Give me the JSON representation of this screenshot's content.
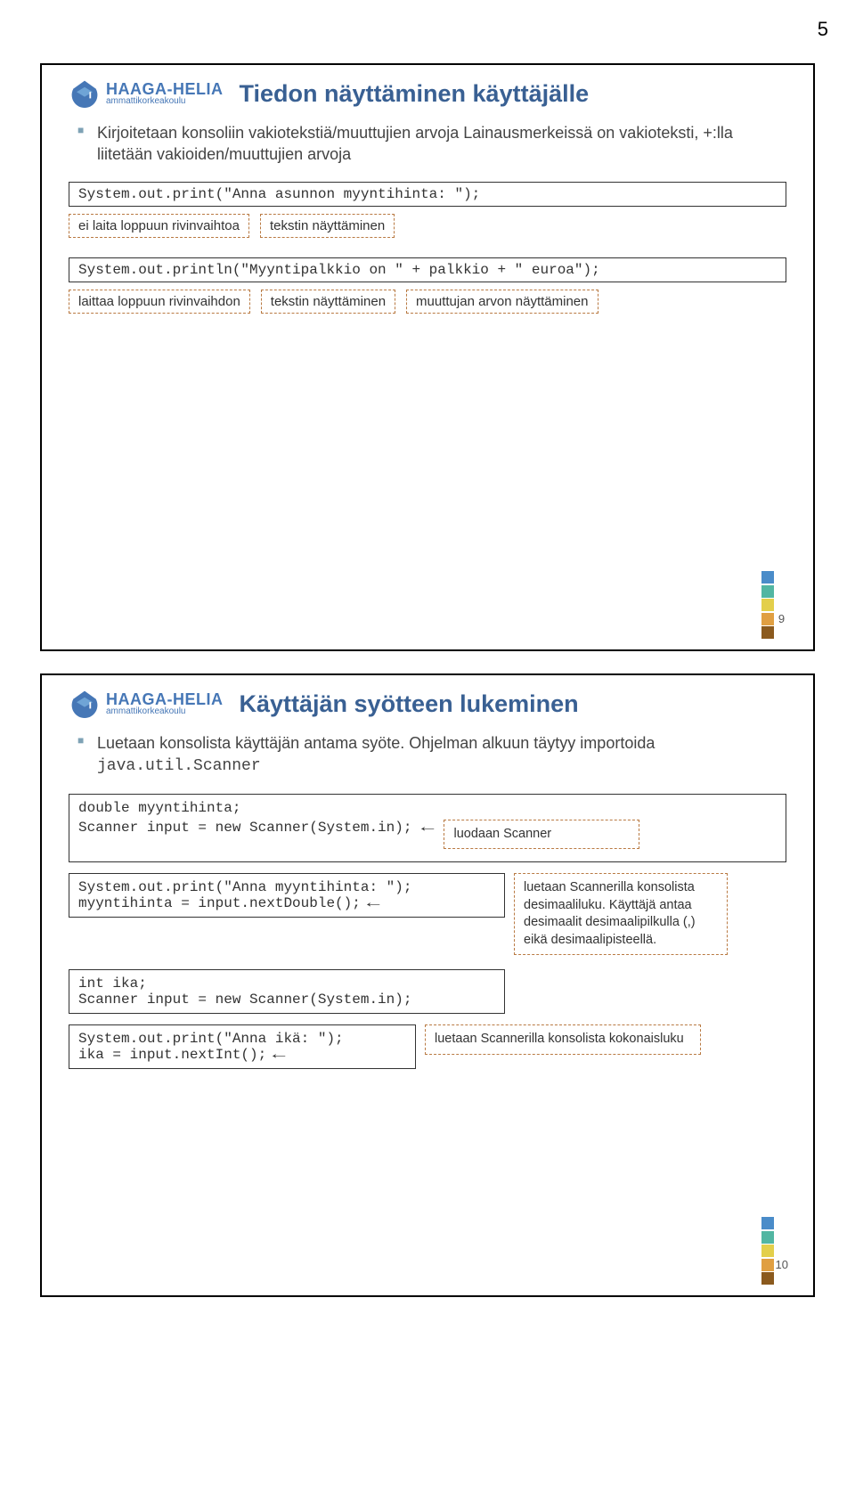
{
  "page_number_top": "5",
  "logo": {
    "main": "HAAGA-HELIA",
    "sub": "ammattikorkeakoulu"
  },
  "colors": {
    "accent": "#396093",
    "square_blue": "#4a8cc9",
    "square_teal": "#52b6a2",
    "square_yellow": "#e3cf4b",
    "square_orange": "#e09f42",
    "square_brown": "#8b5a1e"
  },
  "slide1": {
    "title": "Tiedon näyttäminen käyttäjälle",
    "bullet": "Kirjoitetaan konsoliin vakiotekstiä/muuttujien arvoja Lainausmerkeissä on vakioteksti, +:lla liitetään vakioiden/muuttujien arvoja",
    "code1": "System.out.print(\"Anna asunnon myyntihinta: \");",
    "label_a1": "ei laita loppuun rivinvaihtoa",
    "label_a2": "tekstin näyttäminen",
    "code2": "System.out.println(\"Myyntipalkkio on \" + palkkio + \" euroa\");",
    "label_b1": "laittaa loppuun rivinvaihdon",
    "label_b2": "tekstin näyttäminen",
    "label_b3": "muuttujan arvon näyttäminen",
    "num": "9"
  },
  "slide2": {
    "title": "Käyttäjän syötteen lukeminen",
    "bullet_pre": "Luetaan konsolista käyttäjän antama syöte. Ohjelman alkuun täytyy importoida ",
    "bullet_mono": "java.util.Scanner",
    "block1_l1": "double myyntihinta;",
    "block1_l2": "Scanner input = new Scanner(System.in);",
    "ann1": "luodaan Scanner",
    "block2_l1": "System.out.print(\"Anna myyntihinta: \");",
    "block2_l2": "myyntihinta = input.nextDouble();",
    "ann2": "luetaan Scannerilla konsolista desimaaliluku. Käyttäjä antaa desimaalit desimaalipilkulla (,) eikä desimaalipisteellä.",
    "block3_l1": "int ika;",
    "block3_l2": "Scanner input = new Scanner(System.in);",
    "block4_l1": "System.out.print(\"Anna ikä: \");",
    "block4_l2": "ika = input.nextInt();",
    "ann3": "luetaan Scannerilla konsolista kokonaisluku",
    "num": "10"
  }
}
